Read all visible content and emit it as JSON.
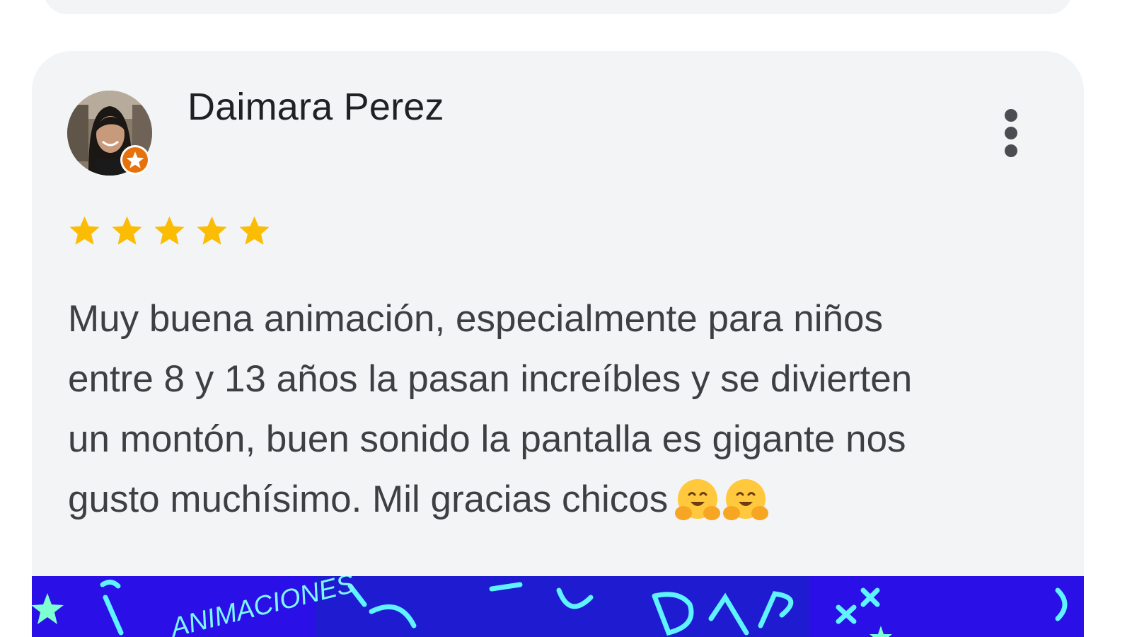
{
  "review": {
    "reviewer_name": "Daimara Perez",
    "rating": 5,
    "rating_max": 5,
    "text_lines": [
      "Muy buena animación, especialmente para niños",
      "entre 8 y 13 años la pasan increíbles y se divierten",
      "un montón, buen sonido la pantalla es gigante nos",
      "gusto muchísimo. Mil gracias chicos"
    ],
    "emojis": [
      "🤗",
      "🤗"
    ],
    "photo_text": "ANIMACIONES"
  },
  "icons": {
    "avatar_badge": "local-guide-star-icon",
    "more": "more-vert-icon",
    "star": "star-icon",
    "emoji": "hugging-face-emoji"
  },
  "colors": {
    "card_background": "#f3f4f6",
    "star": "#fbbc04",
    "badge": "#e8710a",
    "photo_background": "#2a0fe6",
    "photo_neon": "#5ff2ff"
  }
}
